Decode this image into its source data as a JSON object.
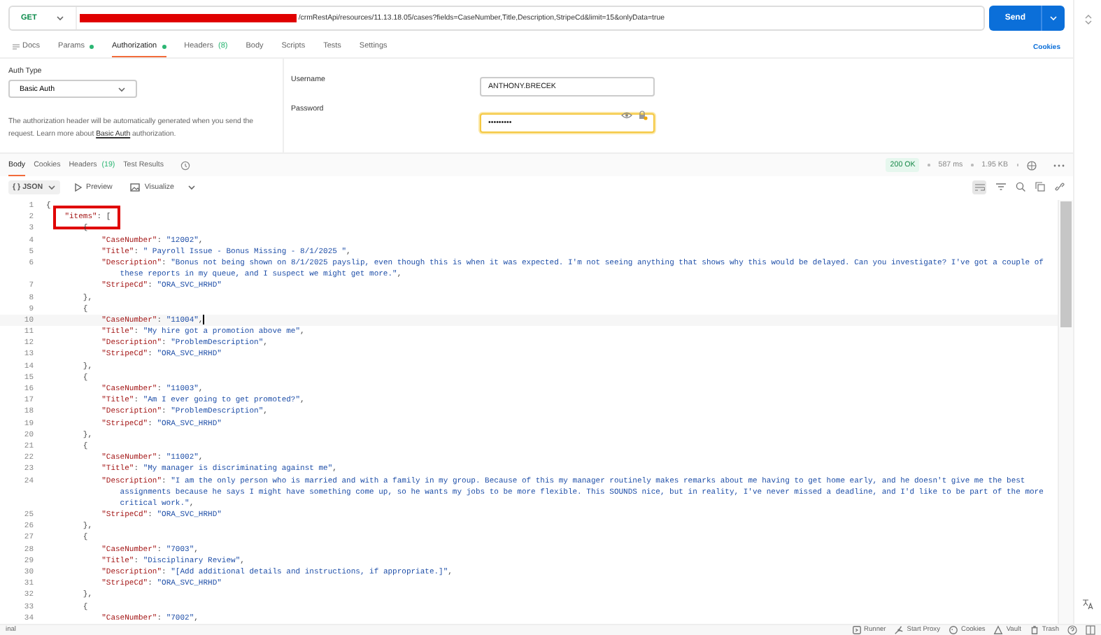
{
  "request": {
    "method": "GET",
    "url": "/crmRestApi/resources/11.13.18.05/cases?fields=CaseNumber,Title,Description,StripeCd&limit=15&onlyData=true",
    "redacted": true,
    "send": "Send"
  },
  "request_tabs": [
    {
      "kind": "docs",
      "label": "Docs",
      "selected": false,
      "dot": false
    },
    {
      "kind": "tab",
      "label": "Params",
      "selected": false,
      "dot": true
    },
    {
      "kind": "tab",
      "label": "Authorization",
      "selected": true,
      "dot": true
    },
    {
      "kind": "tab",
      "label": "Headers",
      "count": "(8)",
      "selected": false,
      "dot": false
    },
    {
      "kind": "tab",
      "label": "Body",
      "selected": false,
      "dot": false
    },
    {
      "kind": "tab",
      "label": "Scripts",
      "selected": false,
      "dot": false
    },
    {
      "kind": "tab",
      "label": "Tests",
      "selected": false,
      "dot": false
    },
    {
      "kind": "tab",
      "label": "Settings",
      "selected": false,
      "dot": false
    }
  ],
  "cookies_link": "Cookies",
  "auth": {
    "type_label": "Auth Type",
    "type": "Basic Auth",
    "description": "The authorization header will be automatically generated when you send the request. Learn more about ",
    "link": "Basic Auth",
    "description_end": " authorization.",
    "username_label": "Username",
    "username": "ANTHONY.BRECEK",
    "password_label": "Password",
    "password": "•••••••••",
    "password_focused": true
  },
  "response_tabs": [
    {
      "label": "Body",
      "selected": true
    },
    {
      "label": "Cookies",
      "selected": false
    },
    {
      "label": "Headers",
      "count": "(19)",
      "selected": false
    },
    {
      "label": "Test Results",
      "selected": false
    }
  ],
  "response_meta": {
    "status": "200 OK",
    "time": "587 ms",
    "size": "1.95 KB"
  },
  "toolbar": {
    "format_icon": "{ }",
    "format": "JSON",
    "views": [
      {
        "kind": "preview",
        "label": "Preview"
      },
      {
        "kind": "visualize",
        "label": "Visualize"
      }
    ],
    "wrap_on": true
  },
  "code_lines": [
    {
      "number": "1",
      "kind": "root",
      "active": false,
      "boxed": false,
      "parts": [
        {
          "kind": "punct",
          "text": "{"
        }
      ]
    },
    {
      "number": "2",
      "kind": "array",
      "active": false,
      "boxed": true,
      "parts": [
        {
          "kind": "key",
          "text": "\"items\""
        },
        {
          "kind": "punct",
          "text": ": ["
        }
      ]
    },
    {
      "number": "3",
      "kind": "object",
      "active": false,
      "boxed": false,
      "parts": [
        {
          "kind": "punct",
          "text": "{"
        }
      ]
    },
    {
      "number": "4",
      "kind": "field",
      "active": false,
      "boxed": false,
      "parts": [
        {
          "kind": "key",
          "text": "\"CaseNumber\""
        },
        {
          "kind": "punct",
          "text": ": "
        },
        {
          "kind": "string",
          "text": "\"12002\""
        },
        {
          "kind": "punct",
          "text": ","
        }
      ]
    },
    {
      "number": "5",
      "kind": "field",
      "active": false,
      "boxed": false,
      "parts": [
        {
          "kind": "key",
          "text": "\"Title\""
        },
        {
          "kind": "punct",
          "text": ": "
        },
        {
          "kind": "string",
          "text": "\" Payroll Issue - Bonus Missing - 8/1/2025 \""
        },
        {
          "kind": "punct",
          "text": ","
        }
      ]
    },
    {
      "number": "6",
      "kind": "field",
      "active": false,
      "boxed": false,
      "parts": [
        {
          "kind": "key",
          "text": "\"Description\""
        },
        {
          "kind": "punct",
          "text": ": "
        },
        {
          "kind": "string",
          "text": "\"Bonus not being shown on 8/1/2025 payslip, even though this is when it was expected. I'm not seeing anything that shows why this would be delayed. Can you investigate? I've got a couple of"
        }
      ]
    },
    {
      "kind": "wrap",
      "active": false,
      "boxed": false,
      "parts": [
        {
          "kind": "string",
          "text": "these reports in my queue, and I suspect we might get more.\""
        },
        {
          "kind": "punct",
          "text": ","
        }
      ]
    },
    {
      "number": "7",
      "kind": "field",
      "active": false,
      "boxed": false,
      "parts": [
        {
          "kind": "key",
          "text": "\"StripeCd\""
        },
        {
          "kind": "punct",
          "text": ": "
        },
        {
          "kind": "string",
          "text": "\"ORA_SVC_HRHD\""
        }
      ]
    },
    {
      "number": "8",
      "kind": "object",
      "active": false,
      "boxed": false,
      "parts": [
        {
          "kind": "punct",
          "text": "},"
        }
      ]
    },
    {
      "number": "9",
      "kind": "object",
      "active": false,
      "boxed": false,
      "parts": [
        {
          "kind": "punct",
          "text": "{"
        }
      ]
    },
    {
      "number": "10",
      "kind": "field",
      "active": true,
      "boxed": false,
      "parts": [
        {
          "kind": "key",
          "text": "\"CaseNumber\""
        },
        {
          "kind": "punct",
          "text": ": "
        },
        {
          "kind": "string",
          "text": "\"11004\""
        },
        {
          "kind": "punct",
          "text": ","
        }
      ]
    },
    {
      "number": "11",
      "kind": "field",
      "active": false,
      "boxed": false,
      "parts": [
        {
          "kind": "key",
          "text": "\"Title\""
        },
        {
          "kind": "punct",
          "text": ": "
        },
        {
          "kind": "string",
          "text": "\"My hire got a promotion above me\""
        },
        {
          "kind": "punct",
          "text": ","
        }
      ]
    },
    {
      "number": "12",
      "kind": "field",
      "active": false,
      "boxed": false,
      "parts": [
        {
          "kind": "key",
          "text": "\"Description\""
        },
        {
          "kind": "punct",
          "text": ": "
        },
        {
          "kind": "string",
          "text": "\"ProblemDescription\""
        },
        {
          "kind": "punct",
          "text": ","
        }
      ]
    },
    {
      "number": "13",
      "kind": "field",
      "active": false,
      "boxed": false,
      "parts": [
        {
          "kind": "key",
          "text": "\"StripeCd\""
        },
        {
          "kind": "punct",
          "text": ": "
        },
        {
          "kind": "string",
          "text": "\"ORA_SVC_HRHD\""
        }
      ]
    },
    {
      "number": "14",
      "kind": "object",
      "active": false,
      "boxed": false,
      "parts": [
        {
          "kind": "punct",
          "text": "},"
        }
      ]
    },
    {
      "number": "15",
      "kind": "object",
      "active": false,
      "boxed": false,
      "parts": [
        {
          "kind": "punct",
          "text": "{"
        }
      ]
    },
    {
      "number": "16",
      "kind": "field",
      "active": false,
      "boxed": false,
      "parts": [
        {
          "kind": "key",
          "text": "\"CaseNumber\""
        },
        {
          "kind": "punct",
          "text": ": "
        },
        {
          "kind": "string",
          "text": "\"11003\""
        },
        {
          "kind": "punct",
          "text": ","
        }
      ]
    },
    {
      "number": "17",
      "kind": "field",
      "active": false,
      "boxed": false,
      "parts": [
        {
          "kind": "key",
          "text": "\"Title\""
        },
        {
          "kind": "punct",
          "text": ": "
        },
        {
          "kind": "string",
          "text": "\"Am I ever going to get promoted?\""
        },
        {
          "kind": "punct",
          "text": ","
        }
      ]
    },
    {
      "number": "18",
      "kind": "field",
      "active": false,
      "boxed": false,
      "parts": [
        {
          "kind": "key",
          "text": "\"Description\""
        },
        {
          "kind": "punct",
          "text": ": "
        },
        {
          "kind": "string",
          "text": "\"ProblemDescription\""
        },
        {
          "kind": "punct",
          "text": ","
        }
      ]
    },
    {
      "number": "19",
      "kind": "field",
      "active": false,
      "boxed": false,
      "parts": [
        {
          "kind": "key",
          "text": "\"StripeCd\""
        },
        {
          "kind": "punct",
          "text": ": "
        },
        {
          "kind": "string",
          "text": "\"ORA_SVC_HRHD\""
        }
      ]
    },
    {
      "number": "20",
      "kind": "object",
      "active": false,
      "boxed": false,
      "parts": [
        {
          "kind": "punct",
          "text": "},"
        }
      ]
    },
    {
      "number": "21",
      "kind": "object",
      "active": false,
      "boxed": false,
      "parts": [
        {
          "kind": "punct",
          "text": "{"
        }
      ]
    },
    {
      "number": "22",
      "kind": "field",
      "active": false,
      "boxed": false,
      "parts": [
        {
          "kind": "key",
          "text": "\"CaseNumber\""
        },
        {
          "kind": "punct",
          "text": ": "
        },
        {
          "kind": "string",
          "text": "\"11002\""
        },
        {
          "kind": "punct",
          "text": ","
        }
      ]
    },
    {
      "number": "23",
      "kind": "field",
      "active": false,
      "boxed": false,
      "parts": [
        {
          "kind": "key",
          "text": "\"Title\""
        },
        {
          "kind": "punct",
          "text": ": "
        },
        {
          "kind": "string",
          "text": "\"My manager is discriminating against me\""
        },
        {
          "kind": "punct",
          "text": ","
        }
      ]
    },
    {
      "number": "24",
      "kind": "field",
      "active": false,
      "boxed": false,
      "parts": [
        {
          "kind": "key",
          "text": "\"Description\""
        },
        {
          "kind": "punct",
          "text": ": "
        },
        {
          "kind": "string",
          "text": "\"I am the only person who is married and with a family in my group. Because of this my manager routinely makes remarks about me having to get home early, and he doesn't give me the best"
        }
      ]
    },
    {
      "kind": "wrap",
      "active": false,
      "boxed": false,
      "parts": [
        {
          "kind": "string",
          "text": "assignments because he says I might have something come up, so he wants my jobs to be more flexible. This SOUNDS nice, but in reality, I've never missed a deadline, and I'd like to be part of the more"
        }
      ]
    },
    {
      "kind": "wrap",
      "active": false,
      "boxed": false,
      "parts": [
        {
          "kind": "string",
          "text": "critical work.\""
        },
        {
          "kind": "punct",
          "text": ","
        }
      ]
    },
    {
      "number": "25",
      "kind": "field",
      "active": false,
      "boxed": false,
      "parts": [
        {
          "kind": "key",
          "text": "\"StripeCd\""
        },
        {
          "kind": "punct",
          "text": ": "
        },
        {
          "kind": "string",
          "text": "\"ORA_SVC_HRHD\""
        }
      ]
    },
    {
      "number": "26",
      "kind": "object",
      "active": false,
      "boxed": false,
      "parts": [
        {
          "kind": "punct",
          "text": "},"
        }
      ]
    },
    {
      "number": "27",
      "kind": "object",
      "active": false,
      "boxed": false,
      "parts": [
        {
          "kind": "punct",
          "text": "{"
        }
      ]
    },
    {
      "number": "28",
      "kind": "field",
      "active": false,
      "boxed": false,
      "parts": [
        {
          "kind": "key",
          "text": "\"CaseNumber\""
        },
        {
          "kind": "punct",
          "text": ": "
        },
        {
          "kind": "string",
          "text": "\"7003\""
        },
        {
          "kind": "punct",
          "text": ","
        }
      ]
    },
    {
      "number": "29",
      "kind": "field",
      "active": false,
      "boxed": false,
      "parts": [
        {
          "kind": "key",
          "text": "\"Title\""
        },
        {
          "kind": "punct",
          "text": ": "
        },
        {
          "kind": "string",
          "text": "\"Disciplinary Review\""
        },
        {
          "kind": "punct",
          "text": ","
        }
      ]
    },
    {
      "number": "30",
      "kind": "field",
      "active": false,
      "boxed": false,
      "parts": [
        {
          "kind": "key",
          "text": "\"Description\""
        },
        {
          "kind": "punct",
          "text": ": "
        },
        {
          "kind": "string",
          "text": "\"[Add additional details and instructions, if appropriate.]\""
        },
        {
          "kind": "punct",
          "text": ","
        }
      ]
    },
    {
      "number": "31",
      "kind": "field",
      "active": false,
      "boxed": false,
      "parts": [
        {
          "kind": "key",
          "text": "\"StripeCd\""
        },
        {
          "kind": "punct",
          "text": ": "
        },
        {
          "kind": "string",
          "text": "\"ORA_SVC_HRHD\""
        }
      ]
    },
    {
      "number": "32",
      "kind": "object",
      "active": false,
      "boxed": false,
      "parts": [
        {
          "kind": "punct",
          "text": "},"
        }
      ]
    },
    {
      "number": "33",
      "kind": "object",
      "active": false,
      "boxed": false,
      "parts": [
        {
          "kind": "punct",
          "text": "{"
        }
      ]
    },
    {
      "number": "34",
      "kind": "field",
      "active": false,
      "boxed": false,
      "parts": [
        {
          "kind": "key",
          "text": "\"CaseNumber\""
        },
        {
          "kind": "punct",
          "text": ": "
        },
        {
          "kind": "string",
          "text": "\"7002\""
        },
        {
          "kind": "punct",
          "text": ","
        }
      ]
    }
  ],
  "status_bar": {
    "left": "inal",
    "items": [
      {
        "kind": "runner",
        "label": "Runner"
      },
      {
        "kind": "proxy",
        "label": "Start Proxy"
      },
      {
        "kind": "cookies",
        "label": "Cookies"
      },
      {
        "kind": "vault",
        "label": "Vault"
      },
      {
        "kind": "trash",
        "label": "Trash"
      }
    ]
  }
}
